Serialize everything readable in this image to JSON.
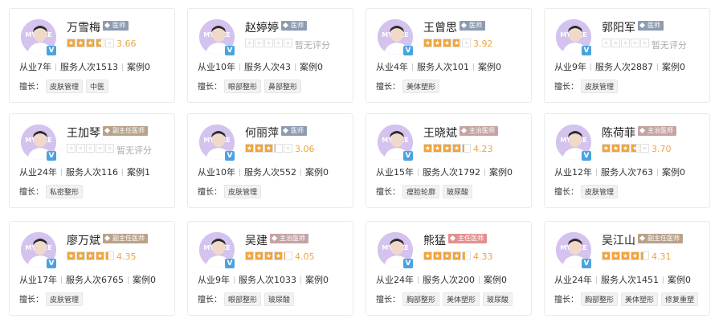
{
  "colors": {
    "star_fill": "#f0a43b",
    "badge_doctor": "#8e9bb0",
    "badge_deputy": "#b9a28a",
    "badge_attending": "#c89a9a",
    "avatar_bg": "#cfbfe8",
    "verified": "#4aa3df"
  },
  "labels": {
    "practice_prefix": "从业",
    "served_prefix": "服务人次",
    "cases_prefix": "案例",
    "skills_label": "擅长：",
    "no_rating": "暂无评分",
    "avatar_brand": "MYLIKE",
    "verified_mark": "V"
  },
  "doctors": [
    {
      "name": "万雪梅",
      "title": "医师",
      "title_type": "doctor",
      "rating": 3.66,
      "score": "3.66",
      "years": "7年",
      "served": "1513",
      "cases": "0",
      "skills": [
        "皮肤管理",
        "中医"
      ]
    },
    {
      "name": "赵婷婷",
      "title": "医师",
      "title_type": "doctor",
      "rating": 0,
      "score": "暂无评分",
      "years": "10年",
      "served": "43",
      "cases": "0",
      "skills": [
        "眼部整形",
        "鼻部整形"
      ]
    },
    {
      "name": "王曾思",
      "title": "医师",
      "title_type": "doctor",
      "rating": 3.92,
      "score": "3.92",
      "years": "4年",
      "served": "101",
      "cases": "0",
      "skills": [
        "美体塑形"
      ]
    },
    {
      "name": "郭阳军",
      "title": "医师",
      "title_type": "doctor",
      "rating": 0,
      "score": "暂无评分",
      "years": "9年",
      "served": "2887",
      "cases": "0",
      "skills": [
        "皮肤管理"
      ]
    },
    {
      "name": "王加琴",
      "title": "副主任医师",
      "title_type": "deputy",
      "rating": 0,
      "score": "暂无评分",
      "years": "24年",
      "served": "116",
      "cases": "1",
      "skills": [
        "私密整形"
      ]
    },
    {
      "name": "何丽萍",
      "title": "医师",
      "title_type": "doctor",
      "rating": 3.06,
      "score": "3.06",
      "years": "10年",
      "served": "552",
      "cases": "0",
      "skills": [
        "皮肤管理"
      ]
    },
    {
      "name": "王晓斌",
      "title": "主治医师",
      "title_type": "attending",
      "rating": 4.23,
      "score": "4.23",
      "years": "15年",
      "served": "1792",
      "cases": "0",
      "skills": [
        "瘦脸轮廓",
        "玻尿酸"
      ]
    },
    {
      "name": "陈荷菲",
      "title": "主治医师",
      "title_type": "attending",
      "rating": 3.7,
      "score": "3.70",
      "years": "12年",
      "served": "763",
      "cases": "0",
      "skills": [
        "皮肤管理"
      ]
    },
    {
      "name": "廖万斌",
      "title": "副主任医师",
      "title_type": "deputy",
      "rating": 4.35,
      "score": "4.35",
      "years": "17年",
      "served": "6765",
      "cases": "0",
      "skills": [
        "皮肤管理"
      ]
    },
    {
      "name": "吴建",
      "title": "主治医师",
      "title_type": "attending",
      "rating": 4.05,
      "score": "4.05",
      "years": "9年",
      "served": "1033",
      "cases": "0",
      "skills": [
        "眼部整形",
        "玻尿酸"
      ]
    },
    {
      "name": "熊猛",
      "title": "主任医师",
      "title_type": "chief",
      "rating": 4.33,
      "score": "4.33",
      "years": "24年",
      "served": "200",
      "cases": "0",
      "skills": [
        "胸部整形",
        "美体塑形",
        "玻尿酸"
      ]
    },
    {
      "name": "吴江山",
      "title": "副主任医师",
      "title_type": "deputy",
      "rating": 4.31,
      "score": "4.31",
      "years": "24年",
      "served": "1451",
      "cases": "0",
      "skills": [
        "胸部整形",
        "美体塑形",
        "修复重塑"
      ]
    }
  ]
}
